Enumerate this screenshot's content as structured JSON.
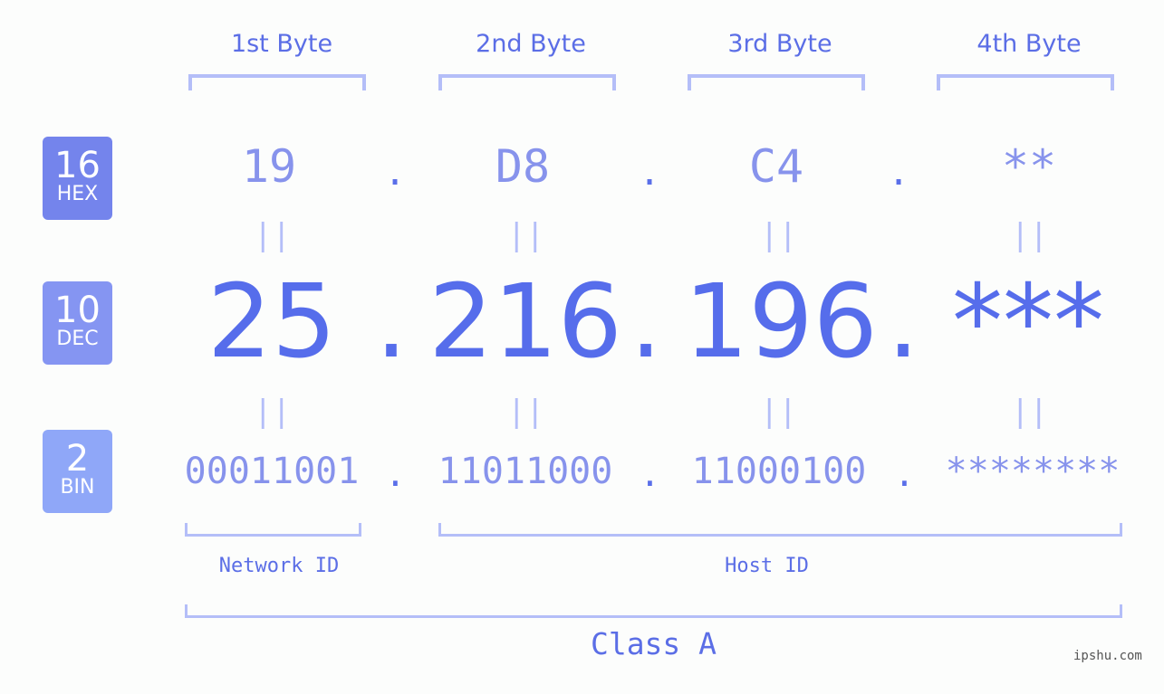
{
  "bytes": {
    "labels": [
      "1st Byte",
      "2nd Byte",
      "3rd Byte",
      "4th Byte"
    ]
  },
  "badges": {
    "hex": {
      "number": "16",
      "label": "HEX",
      "color": "#7484ec"
    },
    "dec": {
      "number": "10",
      "label": "DEC",
      "color": "#8595f2"
    },
    "bin": {
      "number": "2",
      "label": "BIN",
      "color": "#8fa7f8"
    }
  },
  "hex_values": [
    "19",
    "D8",
    "C4",
    "**"
  ],
  "dec_values": [
    "25",
    "216",
    "196",
    "***"
  ],
  "bin_values": [
    "00011001",
    "11011000",
    "11000100",
    "********"
  ],
  "separator": ".",
  "equals": "||",
  "network_label": "Network ID",
  "host_label": "Host ID",
  "class_label": "Class A",
  "watermark": "ipshu.com"
}
